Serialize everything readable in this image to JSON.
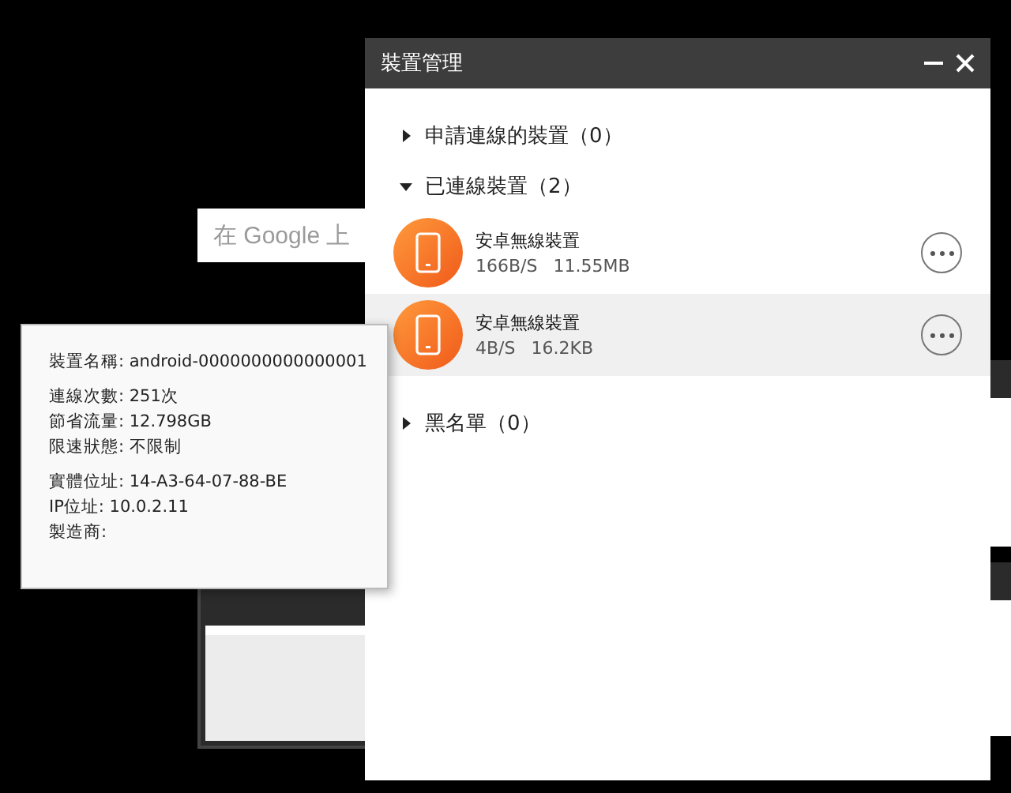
{
  "search": {
    "placeholder": "在 Google 上"
  },
  "window": {
    "title": "裝置管理"
  },
  "groups": [
    {
      "label": "申請連線的裝置（0）",
      "expanded": false
    },
    {
      "label": "已連線裝置（2）",
      "expanded": true,
      "devices": [
        {
          "name": "安卓無線裝置",
          "speed": "166B/S",
          "traffic": "11.55MB",
          "selected": false
        },
        {
          "name": "安卓無線裝置",
          "speed": "4B/S",
          "traffic": "16.2KB",
          "selected": true
        }
      ]
    },
    {
      "label": "黑名單（0）",
      "expanded": false
    }
  ],
  "tooltip": {
    "sections": [
      [
        "裝置名稱: android-0000000000000001"
      ],
      [
        "連線次數: 251次",
        "節省流量: 12.798GB",
        "限速狀態: 不限制"
      ],
      [
        "實體位址: 14-A3-64-07-88-BE",
        "IP位址: 10.0.2.11",
        "製造商:"
      ]
    ]
  }
}
